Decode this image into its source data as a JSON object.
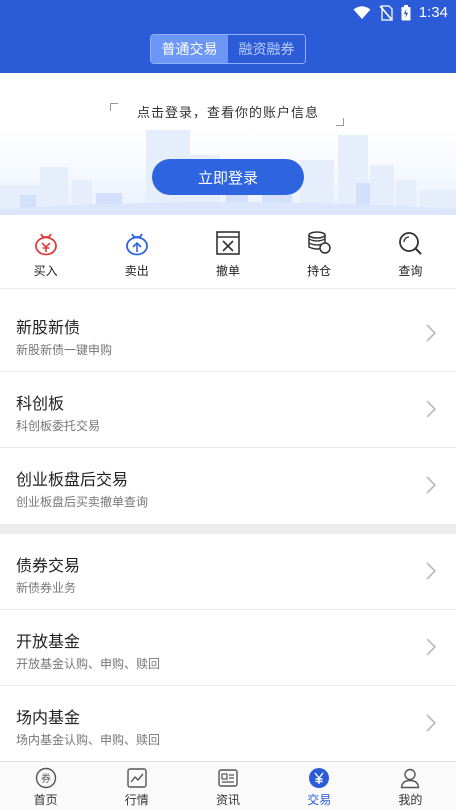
{
  "status_bar": {
    "time": "1:34"
  },
  "header": {
    "segments": [
      {
        "label": "普通交易",
        "active": true
      },
      {
        "label": "融资融券",
        "active": false
      }
    ]
  },
  "login": {
    "prompt": "点击登录，查看你的账户信息",
    "button_label": "立即登录"
  },
  "actions": [
    {
      "label": "买入",
      "icon": "buy-icon"
    },
    {
      "label": "卖出",
      "icon": "sell-icon"
    },
    {
      "label": "撤单",
      "icon": "cancel-order-icon"
    },
    {
      "label": "持仓",
      "icon": "holdings-icon"
    },
    {
      "label": "查询",
      "icon": "search-icon"
    }
  ],
  "menu_group_1": [
    {
      "title": "新股新债",
      "subtitle": "新股新债一键申购"
    },
    {
      "title": "科创板",
      "subtitle": "科创板委托交易"
    },
    {
      "title": "创业板盘后交易",
      "subtitle": "创业板盘后买卖撤单查询"
    }
  ],
  "menu_group_2": [
    {
      "title": "债券交易",
      "subtitle": "新债券业务"
    },
    {
      "title": "开放基金",
      "subtitle": "开放基金认购、申购、赎回"
    },
    {
      "title": "场内基金",
      "subtitle": "场内基金认购、申购、赎回"
    }
  ],
  "tabs": [
    {
      "label": "首页",
      "icon": "home-coupon-icon"
    },
    {
      "label": "行情",
      "icon": "market-chart-icon"
    },
    {
      "label": "资讯",
      "icon": "news-icon"
    },
    {
      "label": "交易",
      "icon": "yuan-icon",
      "active": true
    },
    {
      "label": "我的",
      "icon": "profile-icon"
    }
  ],
  "colors": {
    "brand_blue": "#2b5bd7",
    "buy_red": "#e03b3b",
    "sell_blue": "#2f64e0"
  }
}
